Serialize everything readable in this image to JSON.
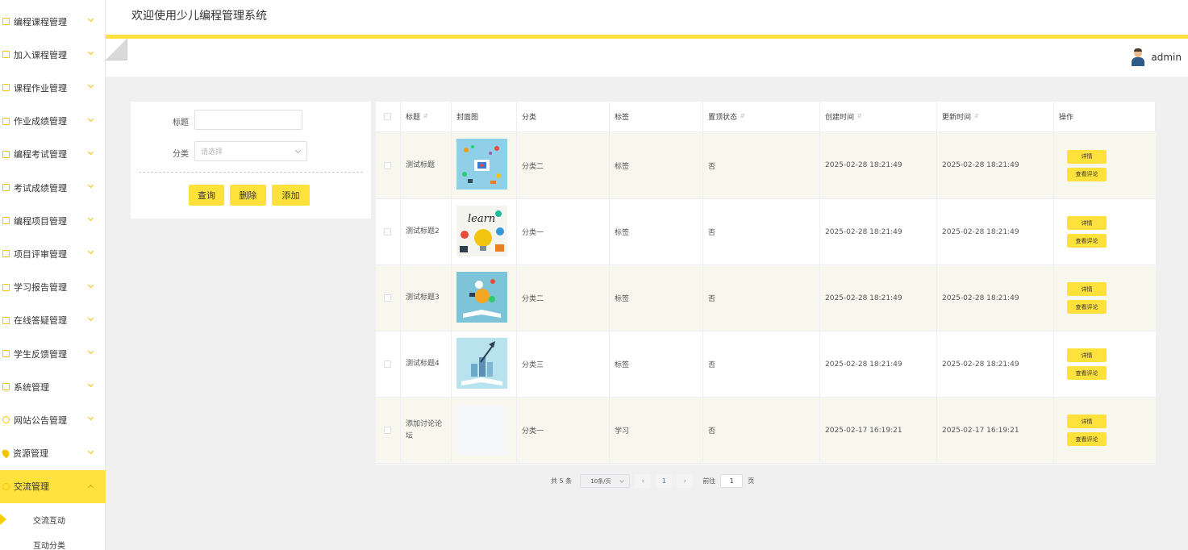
{
  "site_title": "欢迎使用少儿编程管理系统",
  "user": {
    "name": "admin"
  },
  "sidebar": {
    "items": [
      {
        "label": "编程课程管理",
        "icon": "edit-icon"
      },
      {
        "label": "加入课程管理",
        "icon": "edit-icon"
      },
      {
        "label": "课程作业管理",
        "icon": "edit-icon"
      },
      {
        "label": "作业成绩管理",
        "icon": "edit-icon"
      },
      {
        "label": "编程考试管理",
        "icon": "edit-icon"
      },
      {
        "label": "考试成绩管理",
        "icon": "edit-icon"
      },
      {
        "label": "编程项目管理",
        "icon": "edit-icon"
      },
      {
        "label": "项目评审管理",
        "icon": "edit-icon"
      },
      {
        "label": "学习报告管理",
        "icon": "edit-icon"
      },
      {
        "label": "在线答疑管理",
        "icon": "edit-icon"
      },
      {
        "label": "学生反馈管理",
        "icon": "edit-icon"
      },
      {
        "label": "系统管理",
        "icon": "image-icon"
      },
      {
        "label": "网站公告管理",
        "icon": "info-icon"
      },
      {
        "label": "资源管理",
        "icon": "location-icon"
      },
      {
        "label": "交流管理",
        "icon": "chat-icon"
      }
    ],
    "sub_items": [
      {
        "label": "交流互动"
      },
      {
        "label": "互动分类"
      }
    ]
  },
  "search": {
    "title_label": "标题",
    "title_value": "",
    "category_label": "分类",
    "category_placeholder": "请选择",
    "query_button": "查询",
    "delete_button": "删除",
    "add_button": "添加"
  },
  "table": {
    "columns": [
      "标题",
      "封面图",
      "分类",
      "标签",
      "置顶状态",
      "创建时间",
      "更新时间",
      "操作"
    ],
    "rows": [
      {
        "title": "测试标题",
        "category": "分类二",
        "tag": "标签",
        "pinned": "否",
        "created": "2025-02-28 18:21:49",
        "updated": "2025-02-28 18:21:49"
      },
      {
        "title": "测试标题2",
        "category": "分类一",
        "tag": "标签",
        "pinned": "否",
        "created": "2025-02-28 18:21:49",
        "updated": "2025-02-28 18:21:49"
      },
      {
        "title": "测试标题3",
        "category": "分类二",
        "tag": "标签",
        "pinned": "否",
        "created": "2025-02-28 18:21:49",
        "updated": "2025-02-28 18:21:49"
      },
      {
        "title": "测试标题4",
        "category": "分类三",
        "tag": "标签",
        "pinned": "否",
        "created": "2025-02-28 18:21:49",
        "updated": "2025-02-28 18:21:49"
      },
      {
        "title": "添加讨论论坛",
        "category": "分类一",
        "tag": "学习",
        "pinned": "否",
        "created": "2025-02-17 16:19:21",
        "updated": "2025-02-17 16:19:21"
      }
    ],
    "detail_button": "详情",
    "comment_button": "查看评论"
  },
  "pager": {
    "total": "共 5 条",
    "page_size": "10条/页",
    "current_page": "1",
    "goto_label": "前往",
    "goto_value": "1",
    "page_unit": "页"
  },
  "colors": {
    "accent": "#ffe13b",
    "row_alt": "#f7f7ee"
  }
}
